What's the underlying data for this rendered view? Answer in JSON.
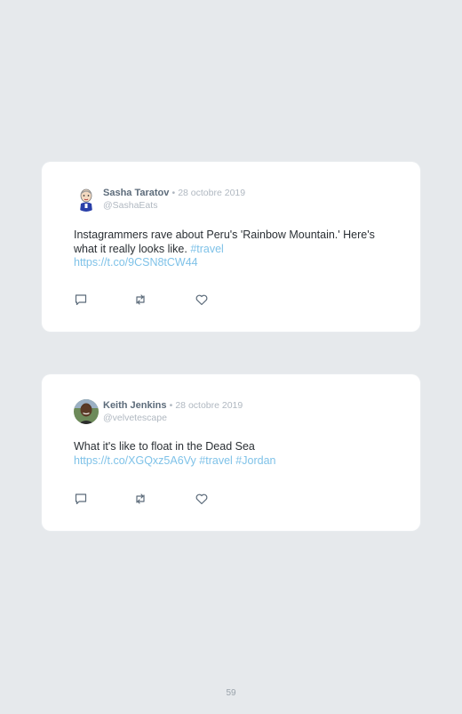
{
  "tweets": [
    {
      "name": "Sasha Taratov",
      "separator": "•",
      "date": "28 octobre 2019",
      "handle": "@SashaEats",
      "text_plain": "Instagrammers rave about Peru's 'Rainbow Mountain.' Here's what it really looks like.",
      "hashtag1": "#travel",
      "url": "https://t.co/9CSN8tCW44",
      "avatar": "cartoon-person-avatar"
    },
    {
      "name": "Keith Jenkins",
      "separator": "•",
      "date": "28 octobre 2019",
      "handle": "@velvetescape",
      "text_plain": "What it's like to float in the Dead Sea",
      "url": "https://t.co/XGQxz5A6Vy",
      "hashtag1": "#travel",
      "hashtag2": "#Jordan",
      "avatar": "photo-avatar"
    }
  ],
  "icons": {
    "reply": "reply-icon",
    "retweet": "retweet-icon",
    "like": "heart-icon"
  },
  "page_number": "59",
  "colors": {
    "background": "#e6e9ec",
    "card": "#ffffff",
    "link": "#7fc2e8",
    "name": "#5c6b7a",
    "muted": "#b0b8c1"
  }
}
